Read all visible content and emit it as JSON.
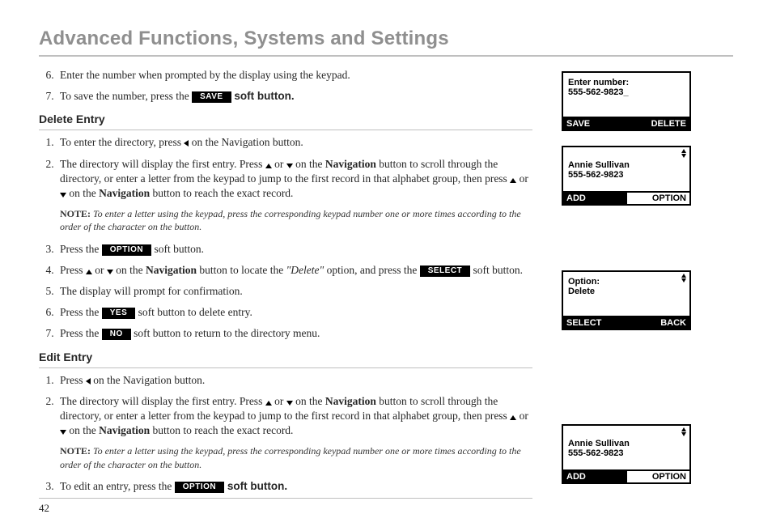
{
  "page_title": "Advanced Functions, Systems and Settings",
  "page_number": "42",
  "top_steps": {
    "s6": "Enter the number when prompted by the display using the keypad.",
    "s7_a": "To save the number, press the ",
    "s7_key": "SAVE",
    "s7_b": " soft button."
  },
  "delete": {
    "heading": "Delete Entry",
    "s1_a": "To enter the directory, press ",
    "s1_b": " on the Navigation button.",
    "s2_a": "The directory will display the first entry.  Press ",
    "s2_b": " or ",
    "s2_c": " on the ",
    "nav": "Navigation",
    "s2_d": " button to scroll through the directory, or enter a letter from the keypad to jump to the first record in that alphabet group, then press ",
    "s2_e": " or ",
    "s2_f": " on the ",
    "s2_g": " button to reach the exact record.",
    "note_label": "NOTE:",
    "note": " To enter a letter using the keypad, press the corresponding keypad number one or more times according to the order of the character on the button.",
    "s3_a": "Press the ",
    "s3_key": "OPTION",
    "s3_b": " soft button.",
    "s4_a": "Press ",
    "s4_b": " or ",
    "s4_c": " on the ",
    "s4_d": " button to locate the ",
    "s4_quote": "\"Delete\"",
    "s4_e": " option, and press the ",
    "s4_key": "SELECT",
    "s4_f": " soft button.",
    "s5": "The display will prompt for confirmation.",
    "s6_a": "Press the ",
    "s6_key": "YES",
    "s6_b": " soft button to delete entry.",
    "s7_a": "Press the ",
    "s7_key": "NO",
    "s7_b": " soft button to return to the directory menu."
  },
  "edit": {
    "heading": "Edit Entry",
    "s1_a": "Press ",
    "s1_b": " on the Navigation button.",
    "s2_a": "The directory will display the first entry. Press ",
    "s2_b": " or ",
    "s2_c": " on the ",
    "nav": "Navigation",
    "s2_d": " button to scroll through the directory, or enter a letter from the keypad to jump to the first record in that alphabet group, then press ",
    "s2_e": " or ",
    "s2_f": " on the ",
    "s2_g": " button to reach the exact record.",
    "note_label": "NOTE:",
    "note": " To enter a letter using the keypad, press the corresponding keypad number one or more times according to the order of the character on the button.",
    "s3_a": "To edit an entry, press the ",
    "s3_key": "OPTION",
    "s3_b": " soft button."
  },
  "screens": {
    "s1": {
      "l1": "Enter number:",
      "l2": "555-562-9823_",
      "left": "SAVE",
      "right": "DELETE"
    },
    "s2": {
      "l1": "Annie Sullivan",
      "l2": "555-562-9823",
      "left": "ADD",
      "right": "OPTION"
    },
    "s3": {
      "l1": "Option:",
      "l2": "Delete",
      "left": "SELECT",
      "right": "BACK"
    },
    "s4": {
      "l1": "Annie Sullivan",
      "l2": "555-562-9823",
      "left": "ADD",
      "right": "OPTION"
    }
  }
}
